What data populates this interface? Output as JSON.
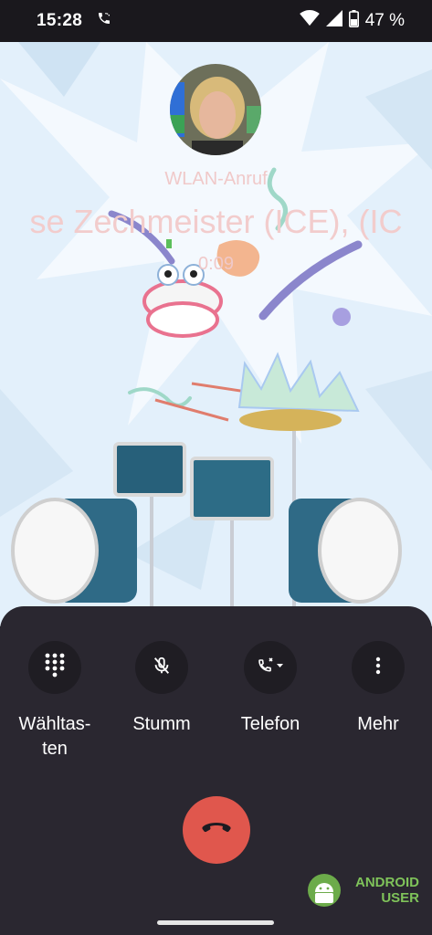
{
  "status_bar": {
    "time": "15:28",
    "battery_percent": "47 %",
    "icons": [
      "call-active-icon",
      "wifi-icon",
      "signal-icon",
      "battery-icon"
    ]
  },
  "call": {
    "type_label": "WLAN-Anruf",
    "caller_name": "se Zechmeister (ICE), (IC",
    "duration": "0:09"
  },
  "controls": [
    {
      "label": "Wähltas-ten",
      "icon": "dialpad-icon"
    },
    {
      "label": "Stumm",
      "icon": "mic-off-icon"
    },
    {
      "label": "Telefon",
      "icon": "phone-audio-route-icon"
    },
    {
      "label": "Mehr",
      "icon": "more-vert-icon"
    }
  ],
  "end_call": {
    "icon": "call-end-icon"
  },
  "watermark": {
    "line1": "ANDROID",
    "line2": "USER"
  },
  "colors": {
    "panel": "#2a2730",
    "button_bg": "#1f1d23",
    "end_call": "#e0574d",
    "wallpaper": "#e3f0fb",
    "watermark_green": "#7fc35a"
  }
}
